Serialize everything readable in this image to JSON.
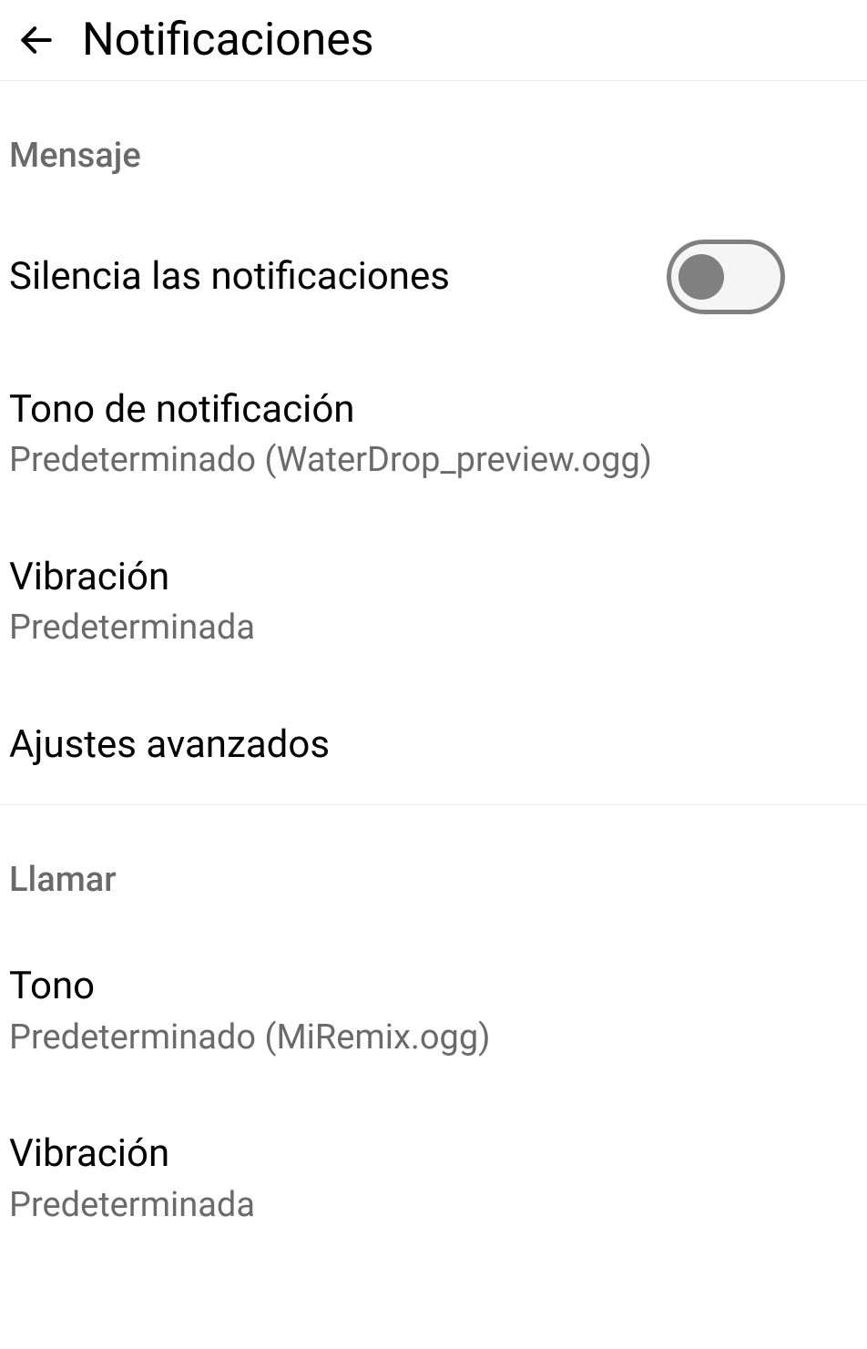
{
  "header": {
    "title": "Notificaciones"
  },
  "sections": {
    "message": {
      "header": "Mensaje",
      "silence": {
        "title": "Silencia las notificaciones"
      },
      "tone": {
        "title": "Tono de notificación",
        "subtitle": "Predeterminado (WaterDrop_preview.ogg)"
      },
      "vibration": {
        "title": "Vibración",
        "subtitle": "Predeterminada"
      },
      "advanced": {
        "title": "Ajustes avanzados"
      }
    },
    "call": {
      "header": "Llamar",
      "tone": {
        "title": "Tono",
        "subtitle": "Predeterminado (MiRemix.ogg)"
      },
      "vibration": {
        "title": "Vibración",
        "subtitle": "Predeterminada"
      }
    }
  }
}
